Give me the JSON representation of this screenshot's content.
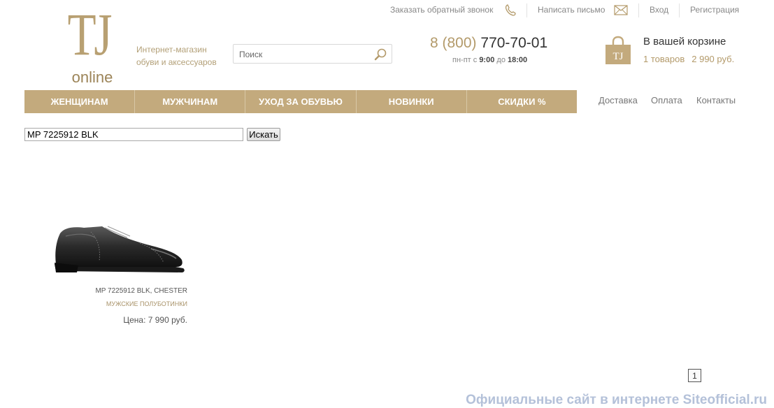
{
  "logo": {
    "mark": "TJ",
    "subtitle": "online"
  },
  "tagline": "Интернет-магазин обуви и аксессуаров",
  "search": {
    "placeholder": "Поиск"
  },
  "top_links": {
    "callback": "Заказать обратный звонок",
    "write": "Написать письмо",
    "login": "Вход",
    "register": "Регистрация"
  },
  "contact": {
    "phone_code": "8 (800)",
    "phone_number": "770-70-01",
    "hours_prefix": "пн-пт с",
    "hours_from": "9:00",
    "hours_mid": "до",
    "hours_to": "18:00"
  },
  "cart": {
    "title": "В вашей корзине",
    "count": "1 товаров",
    "total": "2 990 руб.",
    "icon_label": "TJ"
  },
  "nav": {
    "items": [
      "ЖЕНЩИНАМ",
      "МУЖЧИНАМ",
      "УХОД ЗА ОБУВЬЮ",
      "НОВИНКИ",
      "СКИДКИ %"
    ]
  },
  "sub_links": {
    "delivery": "Доставка",
    "payment": "Оплата",
    "contacts": "Контакты"
  },
  "search_form": {
    "query": "MP 7225912 BLK",
    "button": "Искать"
  },
  "product": {
    "name": "MP 7225912 BLK, CHESTER",
    "category": "МУЖСКИЕ ПОЛУБОТИНКИ",
    "price": "Цена: 7 990 руб."
  },
  "pagination": {
    "current": "1"
  },
  "watermark": "Официальные сайт в интернете Siteofficial.ru",
  "colors": {
    "accent": "#c3aa7d",
    "gold_text": "#b39a6a"
  }
}
